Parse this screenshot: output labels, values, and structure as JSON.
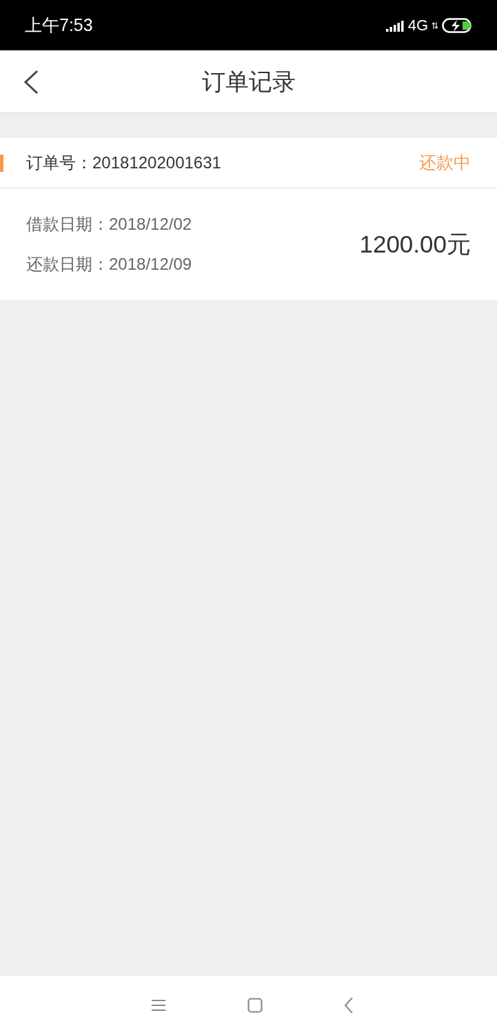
{
  "status_bar": {
    "time": "上午7:53",
    "network": "4G"
  },
  "header": {
    "title": "订单记录"
  },
  "orders": [
    {
      "order_number": "订单号：20181202001631",
      "status": "还款中",
      "loan_date": "借款日期：2018/12/02",
      "repay_date": "还款日期：2018/12/09",
      "amount": "1200.00元"
    }
  ]
}
